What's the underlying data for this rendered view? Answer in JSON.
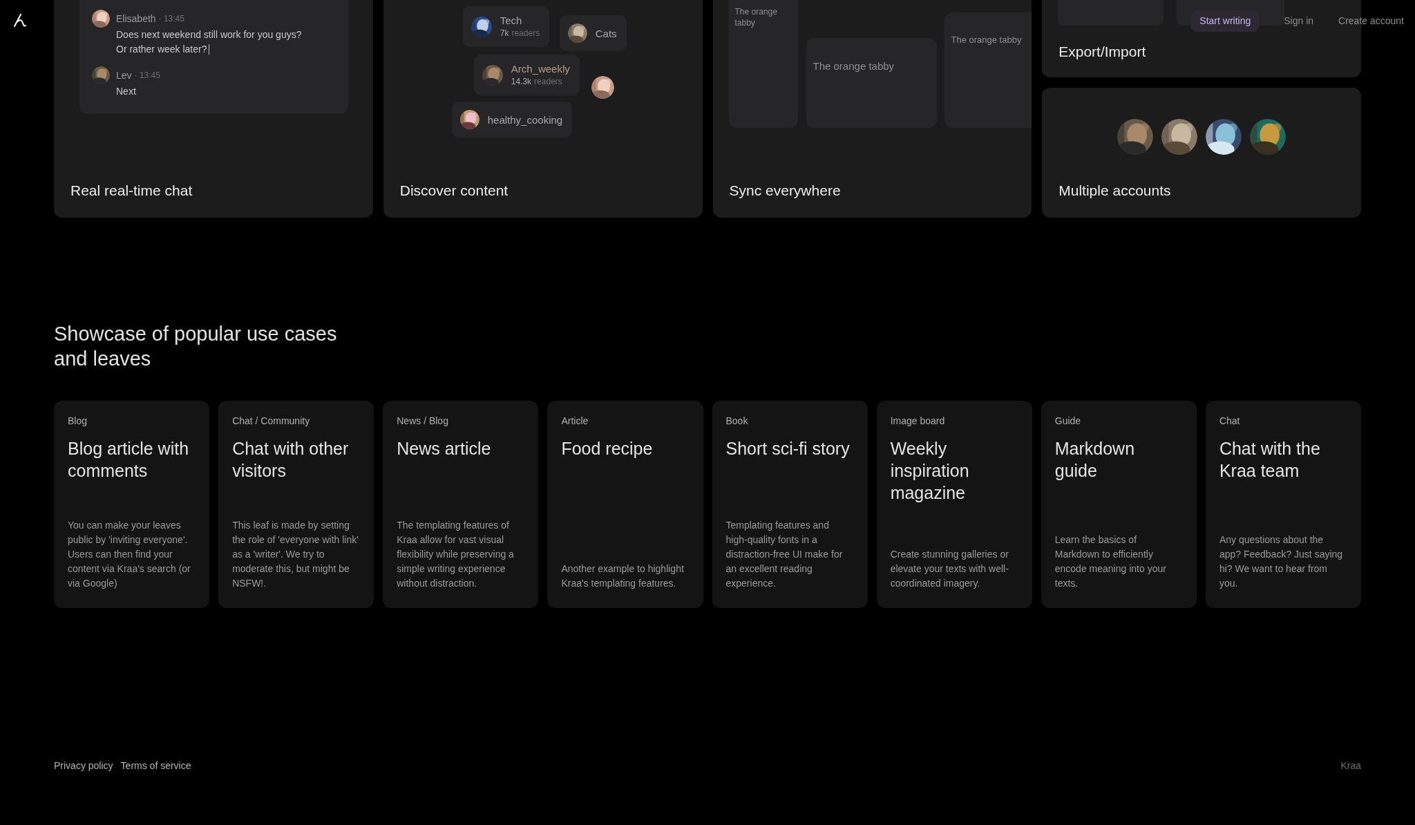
{
  "nav": {
    "start_writing": "Start writing",
    "sign_in": "Sign in",
    "create_account": "Create account"
  },
  "chat_card": {
    "title": "Real real-time chat",
    "messages": [
      {
        "author": "Elisabeth",
        "time": "· 13:45",
        "lines": [
          "Does next weekend still work for you guys?",
          "Or rather week later?"
        ],
        "typing": true
      },
      {
        "author": "Lev",
        "time": "· 13:45",
        "lines": [
          "Next"
        ],
        "typing": false
      }
    ]
  },
  "discover_card": {
    "title": "Discover content",
    "chips": [
      {
        "name": "Tech",
        "readers": "7k",
        "readers_label": "readers",
        "highlighted": false
      },
      {
        "name": "Cats",
        "highlighted": false
      },
      {
        "name": "Arch_weekly",
        "readers": "14.3k",
        "readers_label": "readers",
        "highlighted": true
      },
      {
        "name": "healthy_cooking",
        "highlighted": false
      }
    ]
  },
  "sync_card": {
    "title": "Sync everywhere",
    "notes": [
      {
        "text": "The orange tabby"
      },
      {
        "text": "The orange tabby"
      },
      {
        "text": "The orange tabby"
      }
    ]
  },
  "export_card": {
    "title": "Export/Import"
  },
  "accounts_card": {
    "title": "Multiple accounts"
  },
  "showcase": {
    "heading": "Showcase of popular use cases and leaves",
    "cards": [
      {
        "category": "Blog",
        "title": "Blog article with comments",
        "description": "You can make your leaves public by 'inviting everyone'. Users can then find your content via Kraa's search (or via Google)"
      },
      {
        "category": "Chat / Community",
        "title": "Chat with other visitors",
        "description": "This leaf is made by setting the role of 'everyone with link' as a 'writer'. We try to moderate this, but might be NSFW!."
      },
      {
        "category": "News / Blog",
        "title": "News article",
        "description": "The templating features of Kraa allow for vast visual flexibility while preserving a simple writing experience without distraction."
      },
      {
        "category": "Article",
        "title": "Food recipe",
        "description": "Another example to highlight Kraa's templating features."
      },
      {
        "category": "Book",
        "title": "Short sci-fi story",
        "description": "Templating features and high-quality fonts in a distraction-free UI make for an excellent reading experience."
      },
      {
        "category": "Image board",
        "title": "Weekly inspiration magazine",
        "description": "Create stunning galleries or elevate your texts with well-coordinated imagery."
      },
      {
        "category": "Guide",
        "title": "Markdown guide",
        "description": "Learn the basics of Markdown to efficiently encode meaning into your texts."
      },
      {
        "category": "Chat",
        "title": "Chat with the Kraa team",
        "description": "Any questions about the app? Feedback? Just saying hi? We want to hear from you."
      }
    ]
  },
  "footer": {
    "links": [
      "Privacy policy",
      "Terms of service"
    ],
    "brand": "Kraa"
  }
}
